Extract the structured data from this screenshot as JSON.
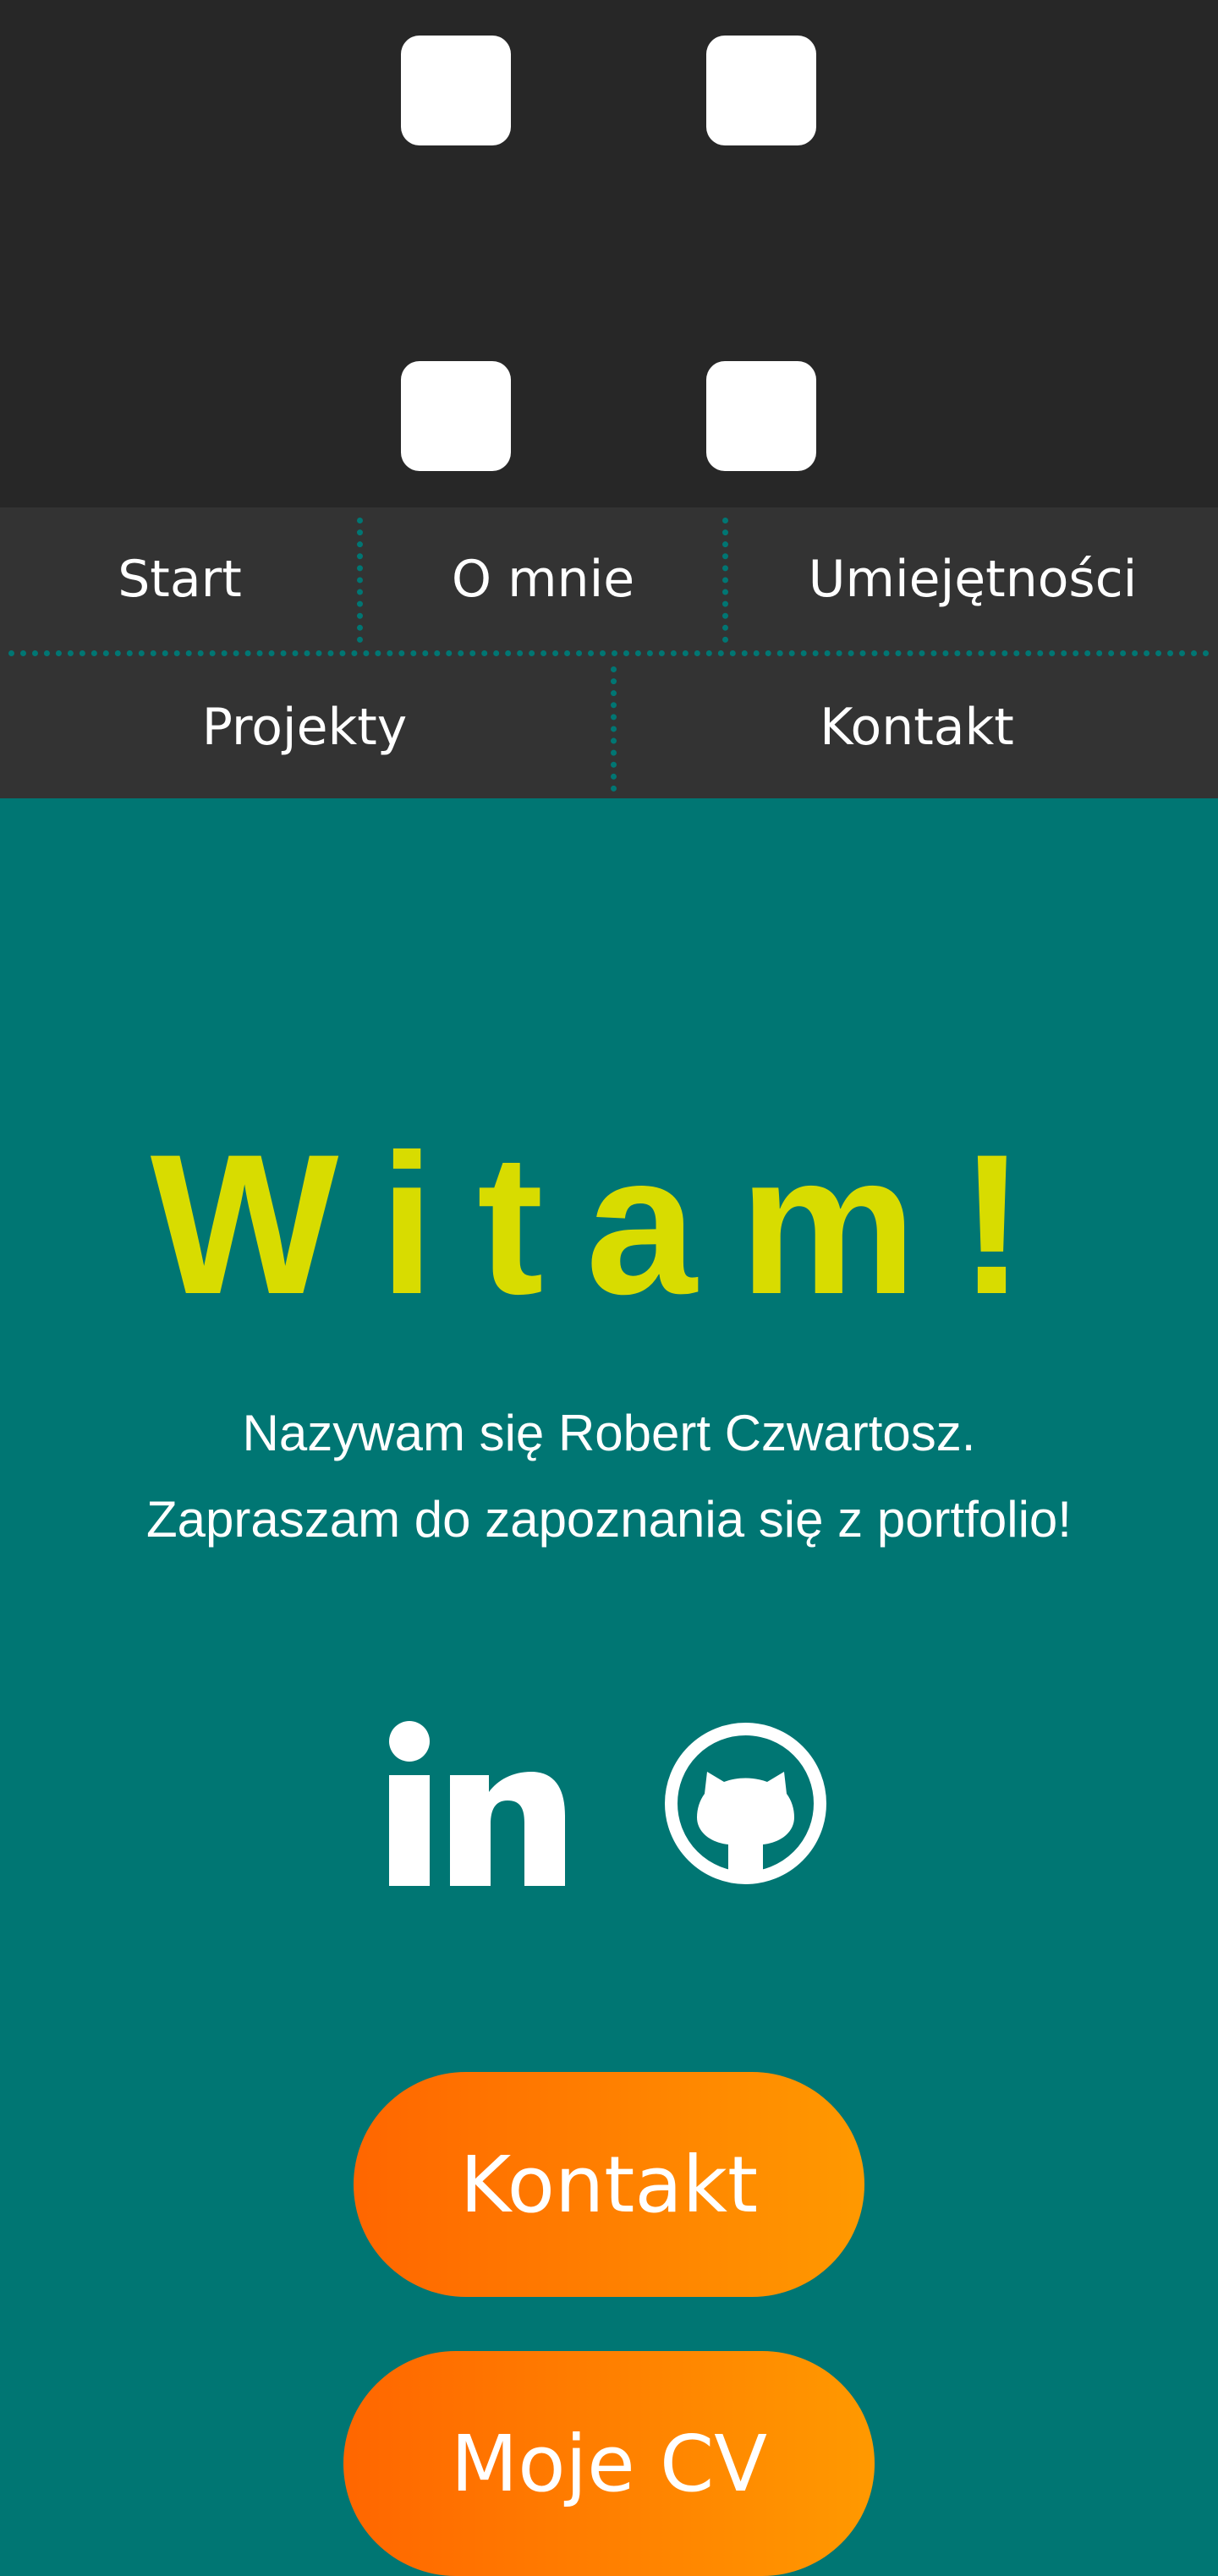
{
  "header": {
    "icons": [
      "square-tile-icon",
      "square-tile-icon",
      "square-tile-icon",
      "square-tile-icon"
    ]
  },
  "nav": {
    "items": [
      {
        "label": "Start"
      },
      {
        "label": "O mnie"
      },
      {
        "label": "Umiejętności"
      },
      {
        "label": "Projekty"
      },
      {
        "label": "Kontakt"
      }
    ]
  },
  "hero": {
    "title": "Witam!",
    "line1": "Nazywam się Robert Czwartosz.",
    "line2": "Zapraszam do zapoznania się z portfolio!",
    "social": [
      "linkedin-icon",
      "github-icon"
    ],
    "buttons": [
      {
        "label": "Kontakt"
      },
      {
        "label": "Moje CV"
      }
    ]
  },
  "colors": {
    "header_bg": "#272727",
    "nav_bg": "#333333",
    "accent_teal": "#007673",
    "title_yellow": "#d8dc00",
    "button_gradient_start": "#ff6600",
    "button_gradient_end": "#ff9900"
  }
}
